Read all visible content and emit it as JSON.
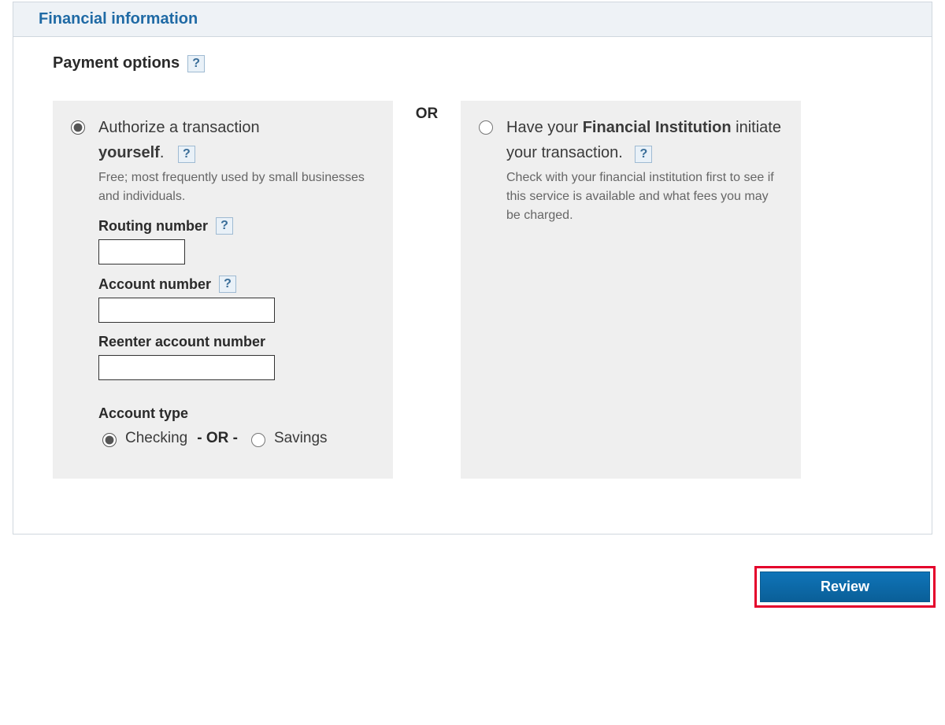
{
  "panel": {
    "title": "Financial information"
  },
  "section": {
    "heading": "Payment options"
  },
  "or_label": "OR",
  "option_self": {
    "title_a": "Authorize a transaction",
    "title_b": "yourself",
    "desc": "Free; most frequently used by small businesses and individuals.",
    "routing_label": "Routing number",
    "account_label": "Account number",
    "reenter_label": "Reenter account number",
    "account_type_label": "Account type",
    "checking_label": "Checking",
    "or_inline": "- OR -",
    "savings_label": "Savings"
  },
  "option_fi": {
    "title_a": "Have your ",
    "title_bold": "Financial Institution",
    "title_b": " initiate your transaction.",
    "desc": "Check with your financial institution first to see if this service is available and what fees you may be charged."
  },
  "buttons": {
    "review": "Review"
  },
  "help_glyph": "?"
}
